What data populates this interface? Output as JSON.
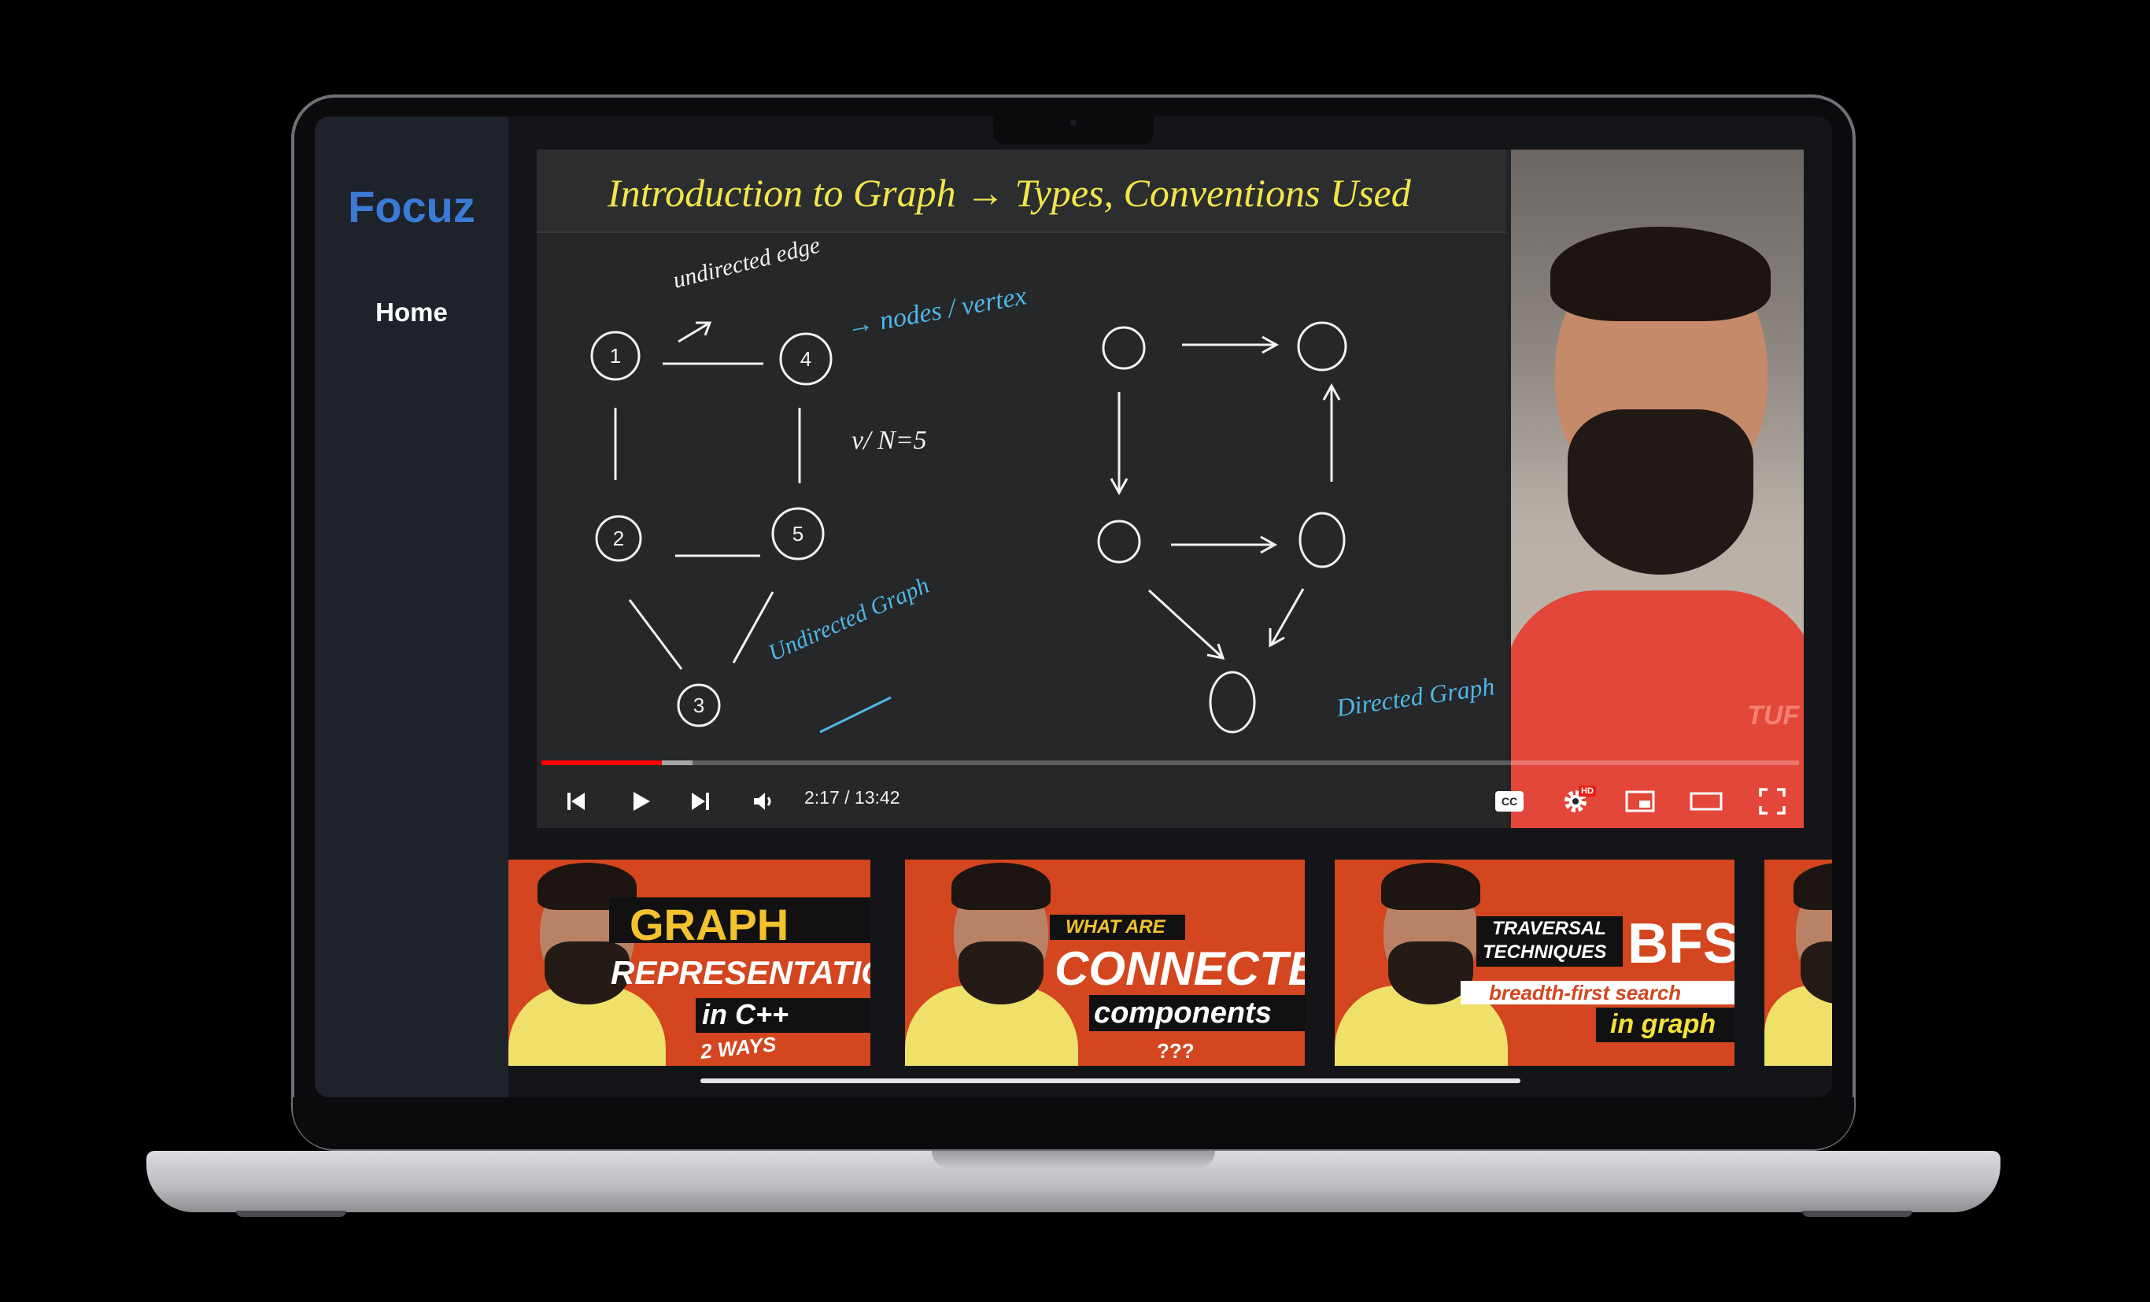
{
  "app": {
    "logo": "Focuz",
    "nav": {
      "home_label": "Home"
    }
  },
  "colors": {
    "accent": "#3a7bd5",
    "progress": "#ff0000",
    "sidebar_bg": "#1e222b"
  },
  "player": {
    "board": {
      "title": "Introduction to Graph → Types, Conventions Used",
      "annotations": {
        "undirected_edge": "undirected edge",
        "nodes_vertex": "→ nodes / vertex",
        "count": "v/ N=5",
        "undirected_graph": "Undirected Graph",
        "directed_graph": "Directed Graph"
      },
      "nodes": [
        "1",
        "4",
        "2",
        "5",
        "3"
      ]
    },
    "presenter_watermark": "TUF",
    "time": "2:17 / 13:42",
    "progress": {
      "played_fraction": 0.096,
      "buffered_fraction": 0.12
    },
    "controls": {
      "previous_icon": "skip-previous-icon",
      "play_icon": "play-icon",
      "next_icon": "skip-next-icon",
      "volume_icon": "volume-icon",
      "cc_label": "CC",
      "settings_icon": "gear-icon",
      "hd_badge": "HD",
      "miniplayer_icon": "miniplayer-icon",
      "theater_icon": "theater-mode-icon",
      "fullscreen_icon": "fullscreen-icon"
    }
  },
  "thumbnails": [
    {
      "line1": "GRAPH",
      "line2": "REPRESENTATION",
      "line3": "in C++",
      "line4": "2 WAYS"
    },
    {
      "line1": "WHAT ARE",
      "line2": "CONNECTED",
      "line3": "components",
      "line4": "???"
    },
    {
      "line1": "TRAVERSAL",
      "line2": "TECHNIQUES",
      "line3": "BFS",
      "line4": "breadth-first search",
      "line5": "in graph"
    }
  ]
}
